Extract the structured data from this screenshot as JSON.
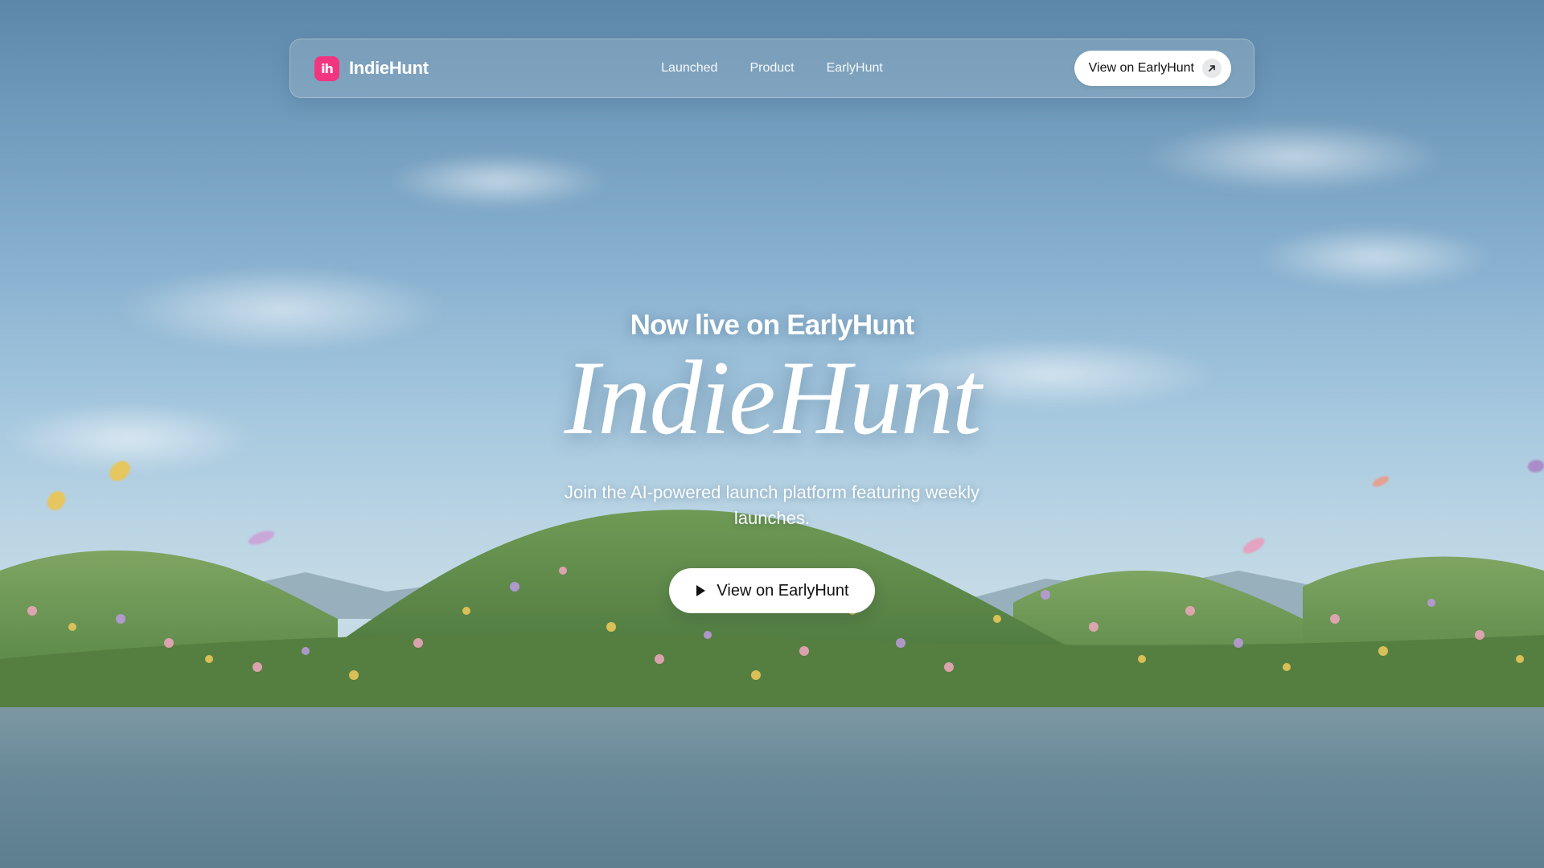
{
  "brand": {
    "logo_text": "ih",
    "name": "IndieHunt",
    "logo_color": "#f2357f"
  },
  "nav": {
    "links": [
      {
        "label": "Launched"
      },
      {
        "label": "Product"
      },
      {
        "label": "EarlyHunt"
      }
    ],
    "cta_label": "View on EarlyHunt",
    "cta_icon": "arrow-up-right-icon"
  },
  "hero": {
    "eyebrow": "Now live on EarlyHunt",
    "title": "IndieHunt",
    "subtitle": "Join the AI-powered launch platform featuring weekly launches.",
    "cta_label": "View on EarlyHunt",
    "cta_icon": "play-icon"
  },
  "colors": {
    "accent": "#f2357f",
    "button_bg": "#ffffff",
    "button_text": "#111111"
  }
}
